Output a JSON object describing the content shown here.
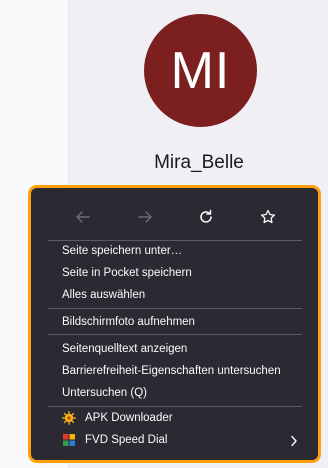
{
  "profile": {
    "initials": "MI",
    "name": "Mira_Belle",
    "avatar_color": "#7b1f1f"
  },
  "context_menu": {
    "border_color": "#ff9f0a",
    "nav": {
      "back_icon": "arrow-left-icon",
      "forward_icon": "arrow-right-icon",
      "reload_icon": "reload-icon",
      "bookmark_icon": "star-icon"
    },
    "items": [
      {
        "label": "Seite speichern unter…"
      },
      {
        "label": "Seite in Pocket speichern"
      },
      {
        "label": "Alles auswählen"
      },
      {
        "label": "Bildschirmfoto aufnehmen"
      },
      {
        "label": "Seitenquelltext anzeigen"
      },
      {
        "label": "Barrierefreiheit-Eigenschaften untersuchen"
      },
      {
        "label": "Untersuchen (Q)"
      }
    ],
    "extensions": [
      {
        "label": "APK Downloader",
        "icon": "apk-downloader-icon"
      },
      {
        "label": "FVD Speed Dial",
        "icon": "fvd-speed-dial-icon",
        "has_submenu": true
      }
    ]
  }
}
